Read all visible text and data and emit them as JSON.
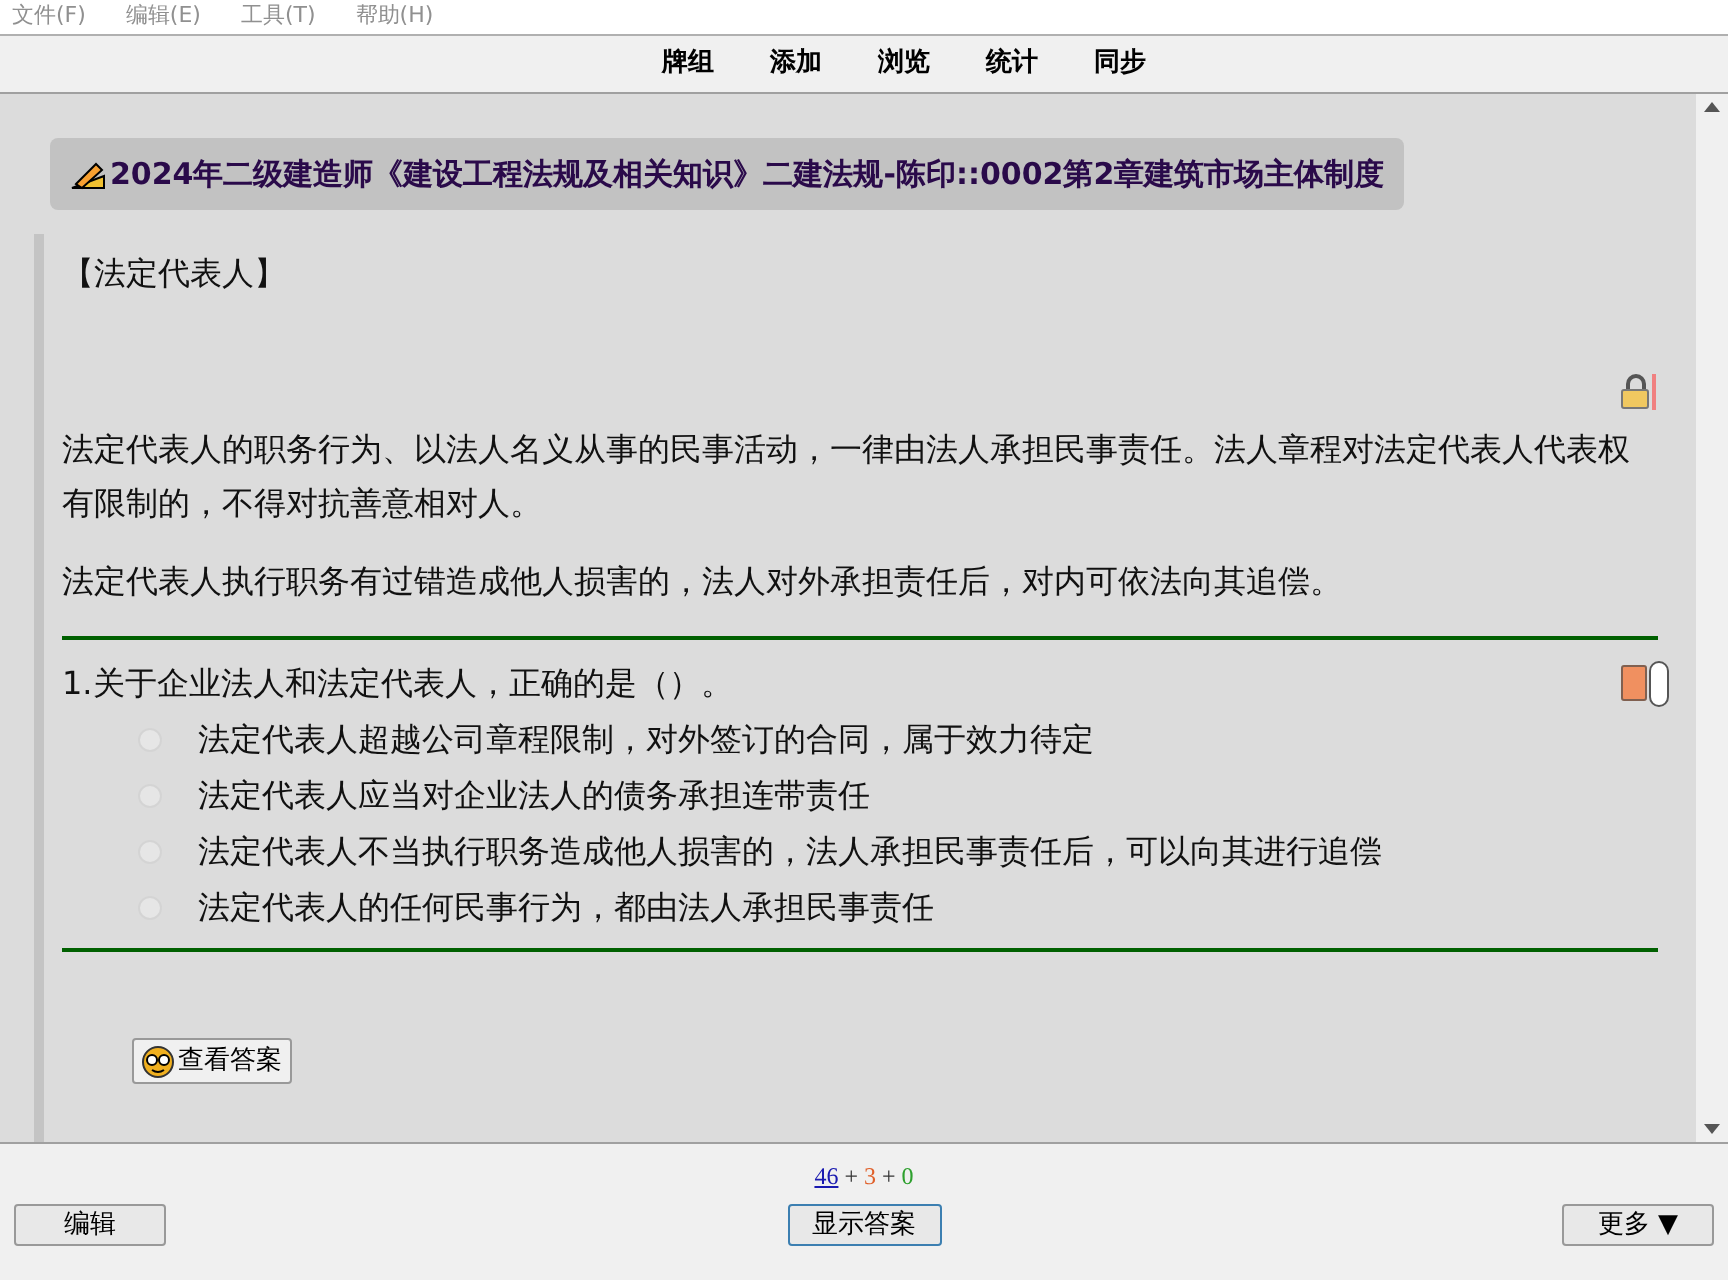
{
  "menu": [
    {
      "label": "文件(F)"
    },
    {
      "label": "编辑(E)"
    },
    {
      "label": "工具(T)"
    },
    {
      "label": "帮助(H)"
    }
  ],
  "toolbar": [
    {
      "label": "牌组"
    },
    {
      "label": "添加"
    },
    {
      "label": "浏览"
    },
    {
      "label": "统计"
    },
    {
      "label": "同步"
    }
  ],
  "deck_title": "2024年二级建造师《建设工程法规及相关知识》二建法规-陈印::0002第2章建筑市场主体制度",
  "card": {
    "heading": "【法定代表人】",
    "paragraphs": [
      "法定代表人的职务行为、以法人名义从事的民事活动，一律由法人承担民事责任。法人章程对法定代表人代表权有限制的，不得对抗善意相对人。",
      "法定代表人执行职务有过错造成他人损害的，法人对外承担责任后，对内可依法向其追偿。"
    ],
    "question": "1.关于企业法人和法定代表人，正确的是（）。",
    "options": [
      {
        "label": "法定代表人超越公司章程限制，对外签订的合同，属于效力待定",
        "selected": false
      },
      {
        "label": "法定代表人应当对企业法人的债务承担连带责任",
        "selected": false
      },
      {
        "label": "法定代表人不当执行职务造成他人损害的，法人承担民事责任后，可以向其进行追偿",
        "selected": false
      },
      {
        "label": "法定代表人的任何民事行为，都由法人承担民事责任",
        "selected": false
      }
    ],
    "reveal_button": "查看答案"
  },
  "footer": {
    "counts": [
      {
        "value": "46",
        "color": "#1a1ab0"
      },
      {
        "value": "3",
        "color": "#e0602a"
      },
      {
        "value": "0",
        "color": "#2ea02e"
      }
    ],
    "separators": [
      "+",
      "+"
    ],
    "edit_button": "编辑",
    "show_answer_button": "显示答案",
    "more_button": "更多 ▼"
  }
}
